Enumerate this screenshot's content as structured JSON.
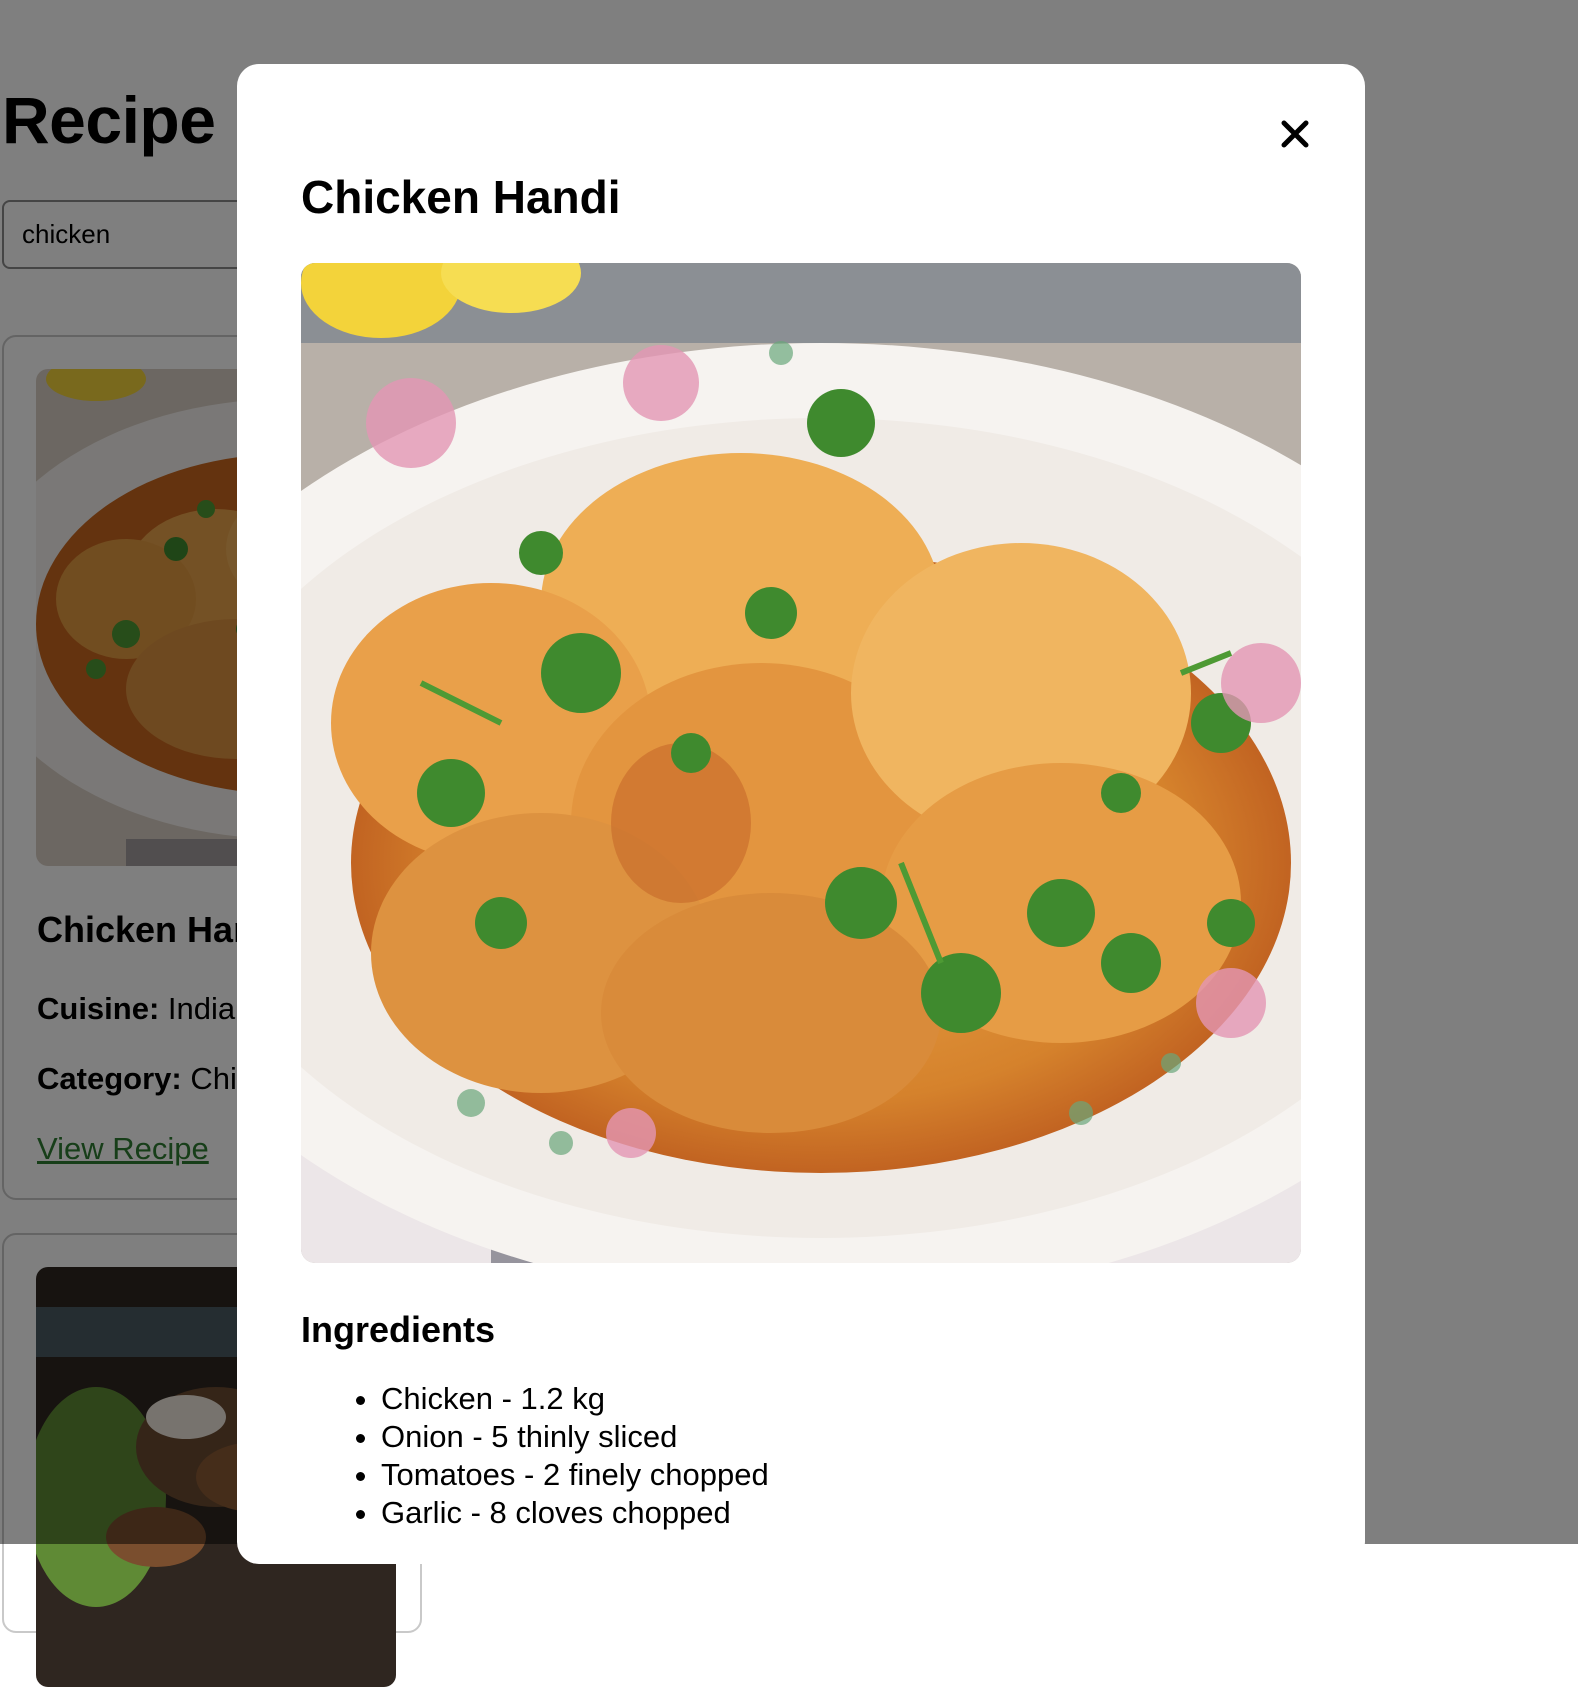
{
  "page": {
    "title": "Recipe Finder",
    "search": {
      "value": "chicken",
      "placeholder": ""
    }
  },
  "cards": [
    {
      "title": "Chicken Handi",
      "cuisine_label": "Cuisine:",
      "cuisine_value": "Indian",
      "category_label": "Category:",
      "category_value": "Chicken",
      "link_label": "View Recipe"
    }
  ],
  "modal": {
    "title": "Chicken Handi",
    "close_icon": "close-icon",
    "ingredients_heading": "Ingredients",
    "ingredients": [
      "Chicken - 1.2 kg",
      "Onion - 5 thinly sliced",
      "Tomatoes - 2 finely chopped",
      "Garlic - 8 cloves chopped"
    ]
  },
  "colors": {
    "overlay": "#000000",
    "link": "#2e7d32",
    "curry": "#e89a3c",
    "plate": "#f4f1ee"
  }
}
